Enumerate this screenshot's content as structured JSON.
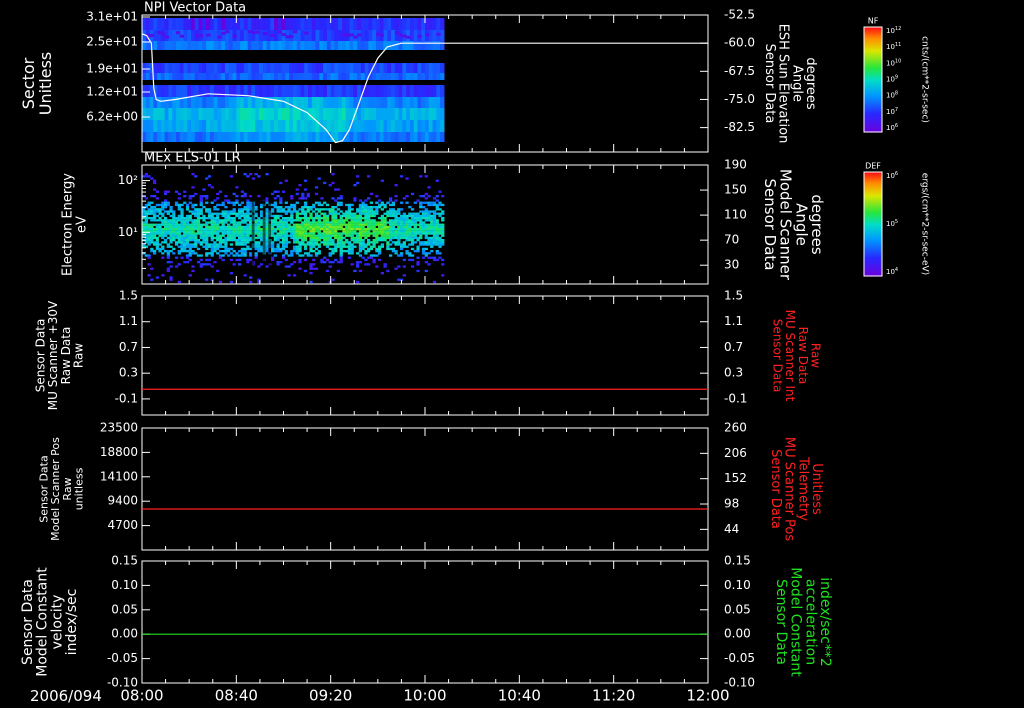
{
  "date_label": "2006/094",
  "colors": {
    "white": "#ffffff",
    "red": "#ff2020",
    "green": "#20e020"
  },
  "chart_data": [
    {
      "id": "p1",
      "type": "heatmap",
      "title": "NPI Vector Data",
      "ylabel_left": [
        "Sector",
        "Unitless"
      ],
      "ylabel_right": [
        "Sensor Data",
        "ESH Sun Elevation",
        "Angle",
        "degrees"
      ],
      "yticks_left": [
        "3.1e+01",
        "2.5e+01",
        "1.9e+01",
        "1.2e+01",
        "6.2e+00"
      ],
      "yticks_right": [
        "-52.5",
        "-60.0",
        "-67.5",
        "-75.0",
        "-82.5"
      ],
      "right_ylim": [
        -89,
        -52.5
      ],
      "data_x_range": [
        "08:00",
        "10:08"
      ],
      "colorbar": {
        "label": "NF",
        "unit": "cnts/(cm**2-sr-sec)",
        "tick_exponents": [
          12,
          11,
          10,
          9,
          8,
          7,
          6
        ]
      },
      "overlay_line": {
        "name": "ESH Sun Elevation",
        "x_min": [
          0,
          2,
          4,
          5,
          6,
          8,
          14,
          28,
          45,
          60,
          70,
          78,
          82,
          85,
          88,
          92,
          96,
          100,
          104,
          110,
          120,
          128,
          240
        ],
        "y": [
          -57.5,
          -58.0,
          -60.0,
          -72.0,
          -75.0,
          -75.5,
          -75.0,
          -73.5,
          -74.0,
          -75.5,
          -78.5,
          -83.0,
          -86.5,
          -86.0,
          -83.0,
          -76.0,
          -69.0,
          -64.0,
          -61.0,
          -60.0,
          -60.0,
          -60.0,
          -60.0
        ]
      }
    },
    {
      "id": "p2",
      "type": "heatmap",
      "title": "MEx ELS-01 LR",
      "ylabel_left": [
        "Electron Energy",
        "eV"
      ],
      "ylabel_right": [
        "Sensor Data",
        "Model Scanner",
        "Angle",
        "degrees"
      ],
      "yticks_left_log": [
        100,
        10
      ],
      "yticks_left": [
        "10²",
        "10¹"
      ],
      "y_log_range": [
        1,
        200
      ],
      "yticks_right": [
        "190",
        "150",
        "110",
        "70",
        "30"
      ],
      "right_ylim": [
        0,
        190
      ],
      "data_x_range": [
        "08:00",
        "10:08"
      ],
      "colorbar": {
        "label": "DEF",
        "unit": "ergs/(cm**2-sr-sec-eV)",
        "tick_exponents": [
          6,
          5,
          4
        ]
      }
    },
    {
      "id": "p3",
      "type": "line",
      "ylabel_left": [
        "Sensor Data",
        "MU Scanner +30V",
        "Raw Data",
        "Raw"
      ],
      "ylabel_right": [
        "Sensor Data",
        "MU Scanner Int",
        "Raw Data",
        "Raw"
      ],
      "ylim": [
        -0.35,
        1.5
      ],
      "yticks": [
        1.5,
        1.1,
        0.7,
        0.3,
        -0.1
      ],
      "yticks_right": [
        1.5,
        1.1,
        0.7,
        0.3,
        -0.1
      ],
      "series": [
        {
          "color": "#ff2020",
          "x": [
            "08:00",
            "12:00"
          ],
          "y": [
            0.05,
            0.05
          ]
        }
      ]
    },
    {
      "id": "p4",
      "type": "line",
      "ylabel_left": [
        "Sensor Data",
        "Model Scanner Pos",
        "Raw",
        "unitless"
      ],
      "ylabel_right": [
        "Sensor Data",
        "MU Scanner Pos",
        "Telemetry",
        "Unitless"
      ],
      "ylim": [
        0,
        23500
      ],
      "yticks": [
        23500,
        18800,
        14100,
        9400,
        4700
      ],
      "right_ylim": [
        0,
        260
      ],
      "yticks_right": [
        260,
        206,
        152,
        98,
        44
      ],
      "series": [
        {
          "color": "#ff2020",
          "x": [
            "08:00",
            "12:00"
          ],
          "y": [
            7900,
            7900
          ]
        }
      ]
    },
    {
      "id": "p5",
      "type": "line",
      "ylabel_left": [
        "Sensor Data",
        "Model Constant",
        "velocity",
        "index/sec"
      ],
      "ylabel_right": [
        "Sensor Data",
        "Model Constant",
        "acceleration",
        "index/sec**2"
      ],
      "ylim": [
        -0.1,
        0.15
      ],
      "yticks": [
        "0.15",
        "0.10",
        "0.05",
        "0.00",
        "-0.05",
        "-0.10"
      ],
      "yticks_right": [
        "0.15",
        "0.10",
        "0.05",
        "0.00",
        "-0.05",
        "-0.10"
      ],
      "series": [
        {
          "color": "#20e020",
          "x": [
            "08:00",
            "12:00"
          ],
          "y": [
            0.0,
            0.0
          ]
        }
      ]
    }
  ],
  "x_axis": {
    "range": [
      "08:00",
      "12:00"
    ],
    "ticks": [
      "08:00",
      "08:40",
      "09:20",
      "10:00",
      "10:40",
      "11:20",
      "12:00"
    ]
  }
}
